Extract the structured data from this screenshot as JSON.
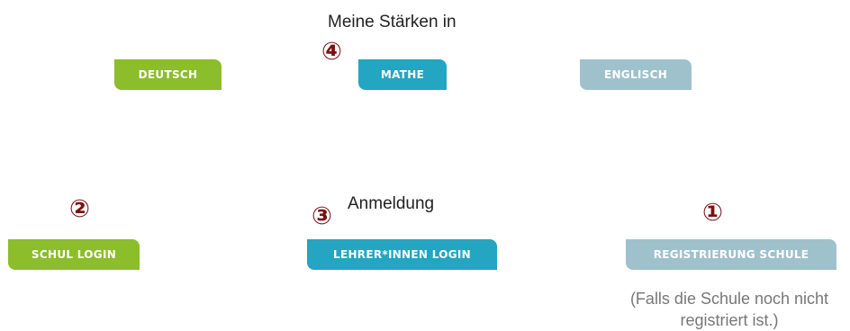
{
  "strengths_section": {
    "heading": "Meine Stärken in",
    "marker": "④",
    "buttons": {
      "deutsch": "DEUTSCH",
      "mathe": "MATHE",
      "englisch": "ENGLISCH"
    }
  },
  "login_section": {
    "heading": "Anmeldung",
    "school_login": {
      "marker": "②",
      "label": "SCHUL LOGIN"
    },
    "teacher_login": {
      "marker": "③",
      "label": "LEHRER*INNEN LOGIN"
    },
    "school_registration": {
      "marker": "①",
      "label": "REGISTRIERUNG SCHULE",
      "note_line1": "(Falls die Schule noch nicht",
      "note_line2": "registriert ist.)"
    }
  },
  "colors": {
    "green": "#8cbd2b",
    "teal": "#24a5c1",
    "gray_blue": "#9fc1cc",
    "marker": "#7a1212"
  }
}
